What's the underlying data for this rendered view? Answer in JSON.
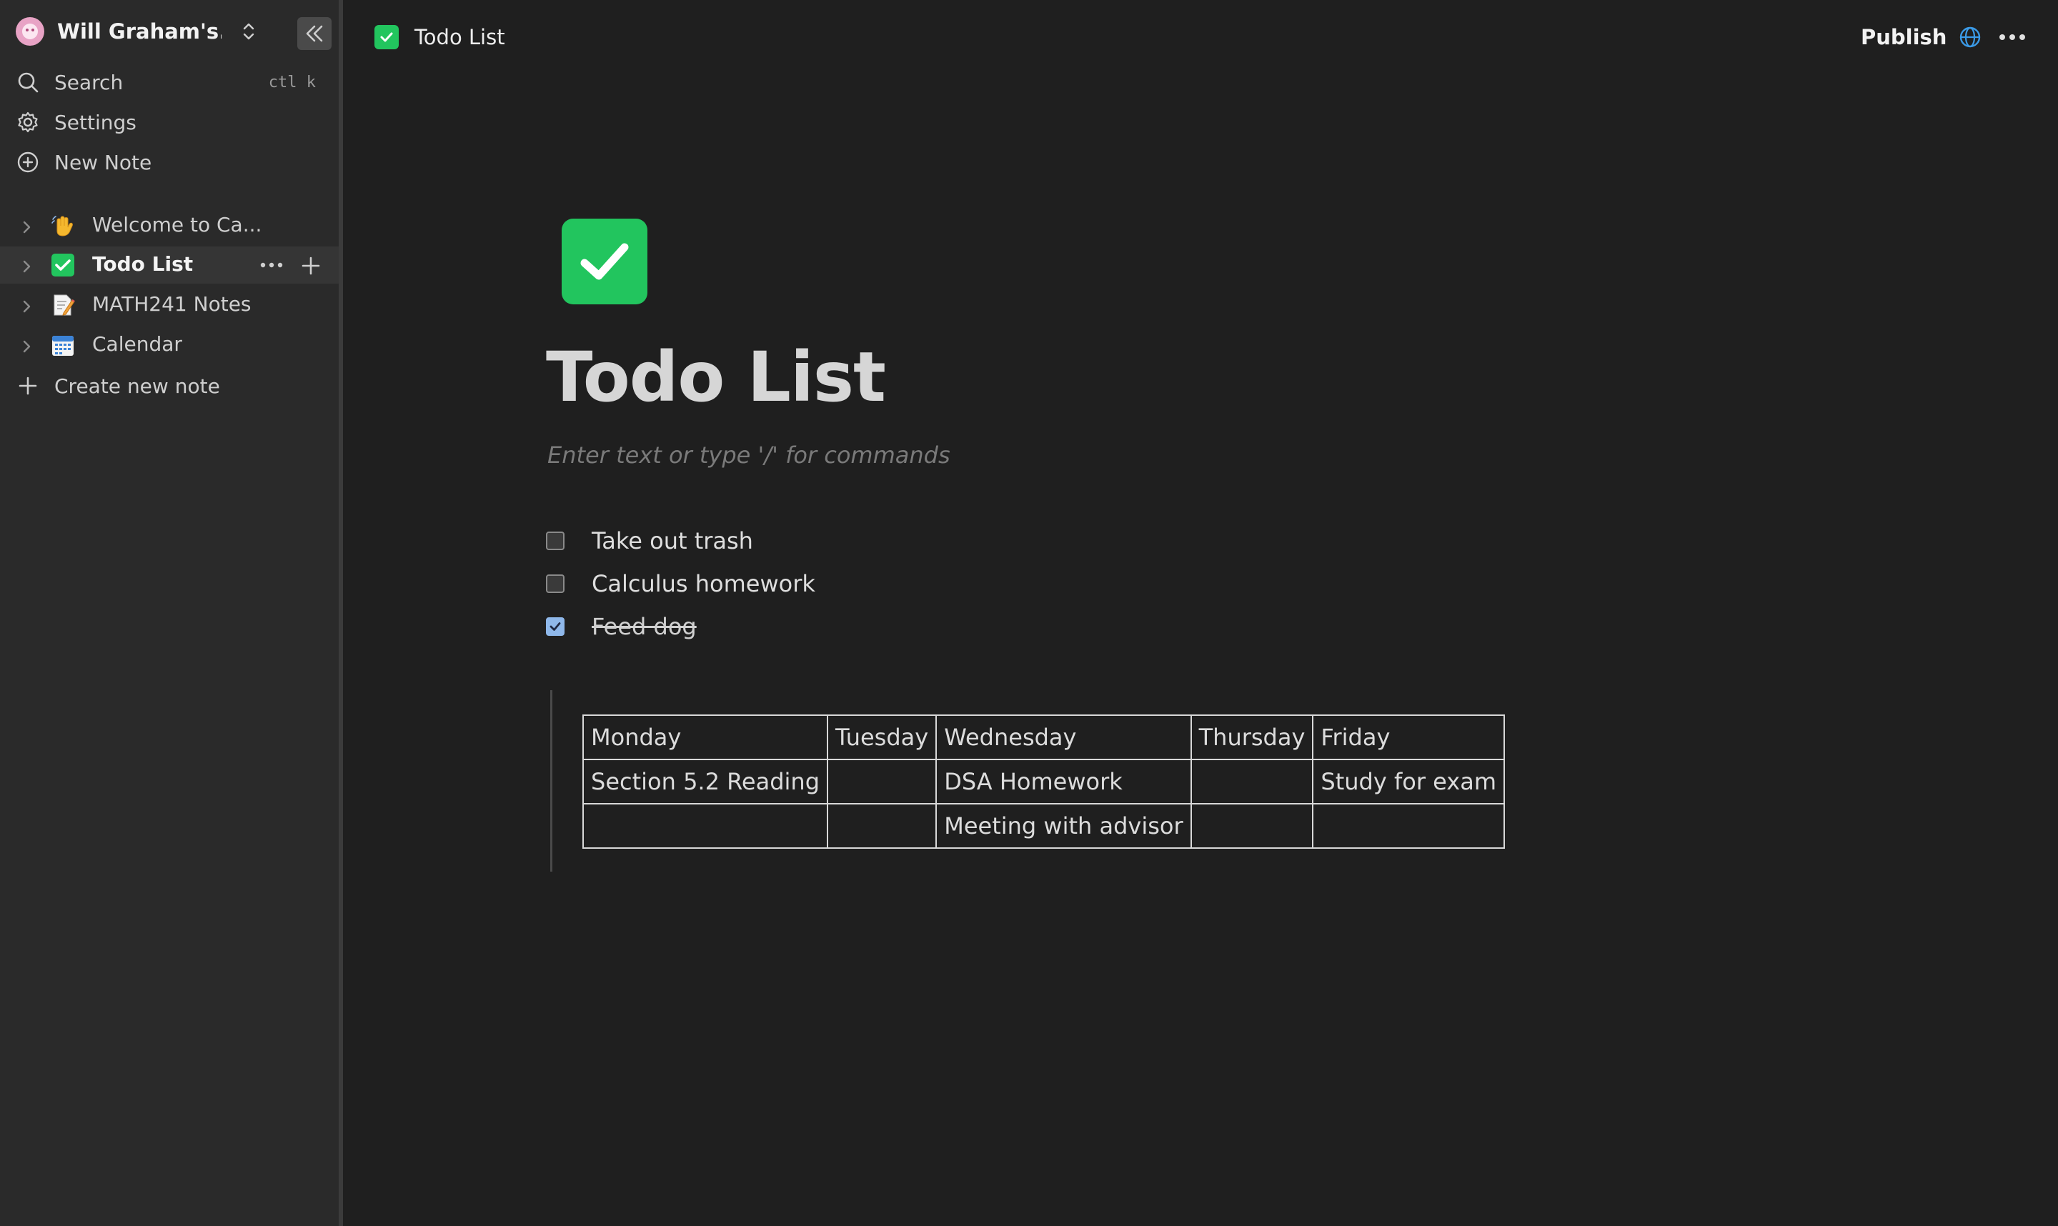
{
  "workspace": {
    "name": "Will Graham's..."
  },
  "sidebar": {
    "nav": [
      {
        "label": "Search",
        "shortcut": "ctl k",
        "icon": "search-icon"
      },
      {
        "label": "Settings",
        "icon": "gear-icon"
      },
      {
        "label": "New Note",
        "icon": "plus-circle-icon"
      }
    ],
    "pages": [
      {
        "label": "Welcome to Ca...",
        "emoji": "👋",
        "icon": "waving-hand-icon"
      },
      {
        "label": "Todo List",
        "icon": "check-box-icon",
        "active": true
      },
      {
        "label": "MATH241 Notes",
        "emoji": "📝",
        "icon": "memo-icon"
      },
      {
        "label": "Calendar",
        "emoji": "📅",
        "icon": "calendar-icon"
      }
    ],
    "create_label": "Create new note"
  },
  "topbar": {
    "title": "Todo List",
    "publish_label": "Publish"
  },
  "document": {
    "title": "Todo List",
    "placeholder": "Enter text or type '/' for commands",
    "todos": [
      {
        "text": "Take out trash",
        "checked": false
      },
      {
        "text": "Calculus homework",
        "checked": false
      },
      {
        "text": "Feed dog",
        "checked": true
      }
    ],
    "table": {
      "rows": [
        [
          "Monday",
          "Tuesday",
          "Wednesday",
          "Thursday",
          "Friday"
        ],
        [
          "Section 5.2 Reading",
          "",
          "DSA Homework",
          "",
          "Study for exam"
        ],
        [
          "",
          "",
          "Meeting with advisor",
          "",
          ""
        ]
      ]
    }
  },
  "colors": {
    "background": "#1f1f1f",
    "sidebar": "#2a2a2a",
    "accent_green": "#22c55e",
    "checkbox_checked": "#8fb8ea",
    "globe_blue": "#3b9be8"
  }
}
